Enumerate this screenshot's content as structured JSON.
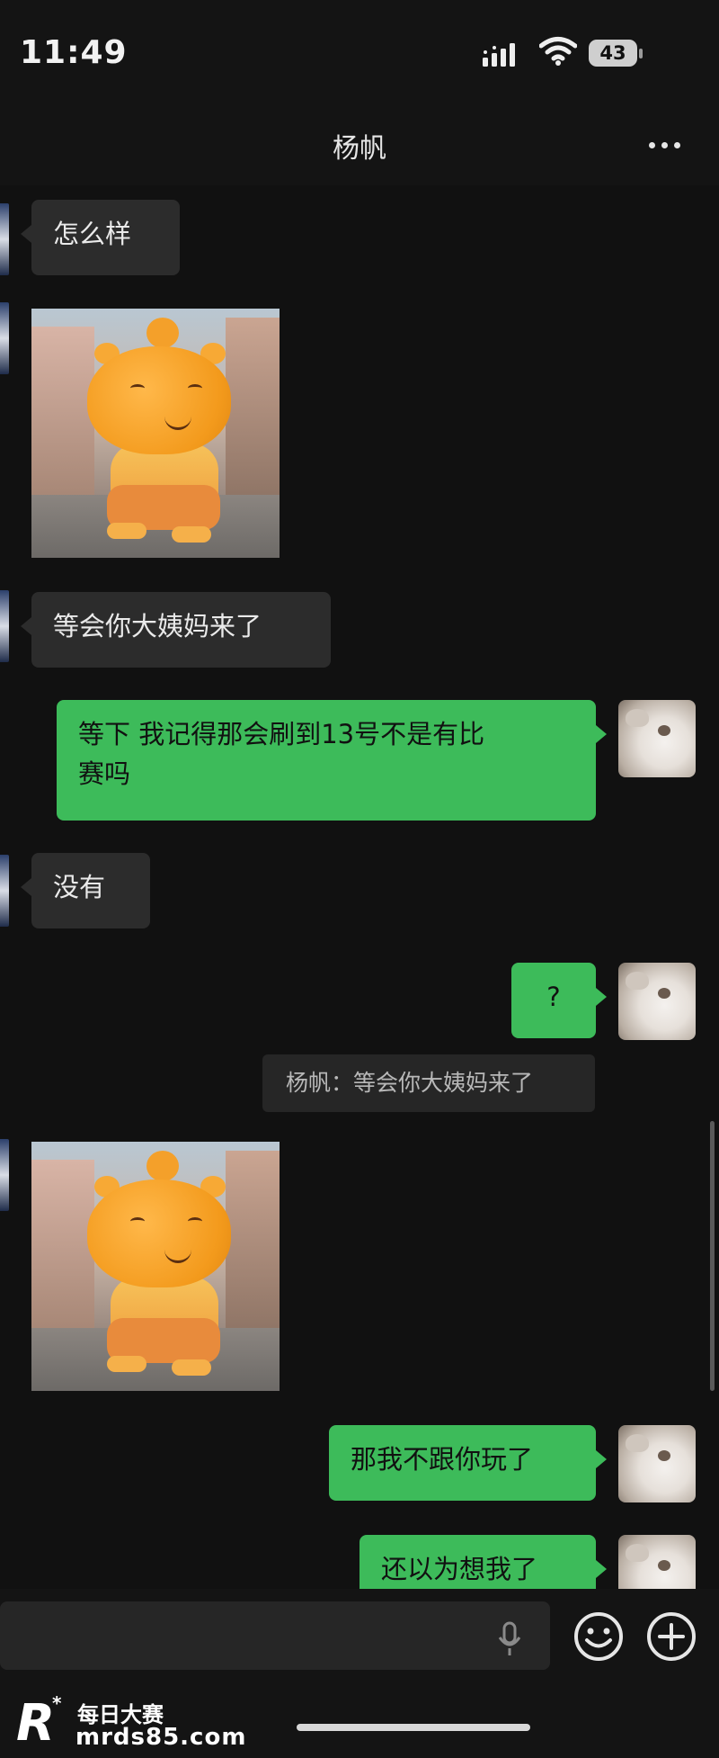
{
  "status_bar": {
    "time": "11:49",
    "battery_level": "43",
    "icons": [
      "signal-icon",
      "wifi-icon",
      "battery-icon"
    ]
  },
  "nav": {
    "title": "杨帆",
    "more_icon": "more-dots-icon"
  },
  "messages": [
    {
      "side": "in",
      "type": "text",
      "text": "怎么样"
    },
    {
      "side": "in",
      "type": "sticker"
    },
    {
      "side": "in",
      "type": "text",
      "text": "等会你大姨妈来了"
    },
    {
      "side": "out",
      "type": "text",
      "text": "等下 我记得那会刷到13号不是有比\n赛吗"
    },
    {
      "side": "in",
      "type": "text",
      "text": "没有"
    },
    {
      "side": "out",
      "type": "text",
      "text": "?",
      "quote": "杨帆：等会你大姨妈来了"
    },
    {
      "side": "in",
      "type": "sticker"
    },
    {
      "side": "out",
      "type": "text",
      "text": "那我不跟你玩了"
    },
    {
      "side": "out",
      "type": "text",
      "text": "还以为想我了"
    }
  ],
  "input_bar": {
    "placeholder": "",
    "icons": [
      "microphone-icon",
      "emoji-icon",
      "plus-icon"
    ]
  },
  "watermark": {
    "name": "每日大赛",
    "url": "mrds85.com"
  },
  "colors": {
    "background": "#111111",
    "incoming_bubble": "#2c2c2c",
    "outgoing_bubble": "#3dbb5a",
    "quote_background": "#262626"
  }
}
